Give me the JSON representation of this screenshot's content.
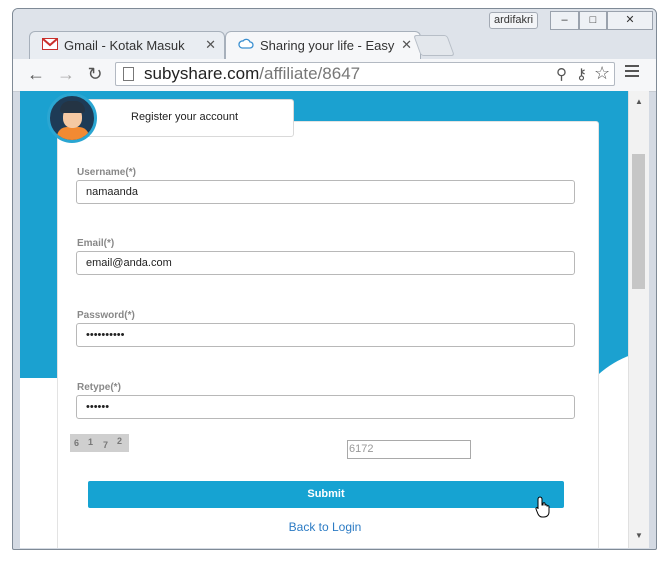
{
  "window": {
    "user_badge": "ardifakri",
    "minimize": "–",
    "maximize": "□",
    "close": "✕"
  },
  "tabs": [
    {
      "title": "Gmail - Kotak Masuk",
      "icon": "gmail-icon",
      "active": false
    },
    {
      "title": "Sharing your life - Easy wa",
      "icon": "cloud-icon",
      "active": true
    }
  ],
  "toolbar": {
    "url_host": "subyshare.com",
    "url_path": "/affiliate/8647"
  },
  "page": {
    "header": "Register your account",
    "username": {
      "label": "Username(*)",
      "value": "namaanda"
    },
    "email": {
      "label": "Email(*)",
      "value": "email@anda.com"
    },
    "password": {
      "label": "Password(*)",
      "value": "••••••••••"
    },
    "retype": {
      "label": "Retype(*)",
      "value": "••••••"
    },
    "captcha_digits": [
      "6",
      "1",
      "7",
      "2"
    ],
    "captcha_input": "6172",
    "submit": "Submit",
    "back_link": "Back to Login"
  },
  "colors": {
    "brand_blue": "#1ba1d0",
    "button_blue": "#16a3d2",
    "link_blue": "#2c7bc4"
  }
}
